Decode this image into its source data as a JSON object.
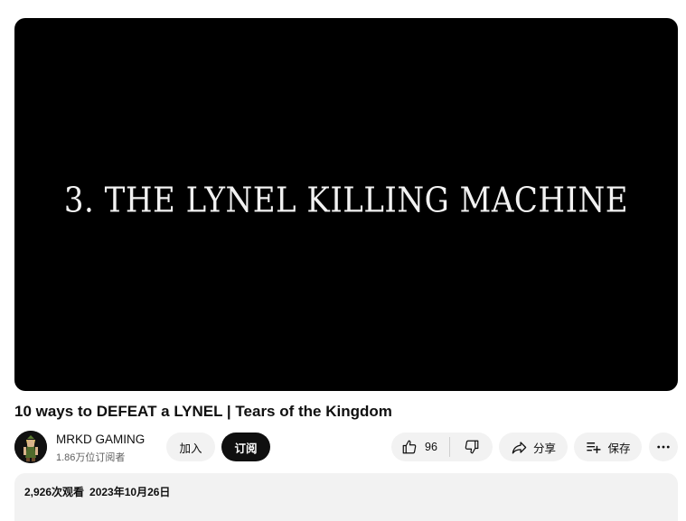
{
  "player": {
    "caption": "3. THE LYNEL KILLING MACHINE"
  },
  "video": {
    "title": "10 ways to DEFEAT a LYNEL | Tears of the Kingdom"
  },
  "channel": {
    "name": "MRKD GAMING",
    "subscribers": "1.86万位订阅者",
    "avatar_icon": "link-character-avatar"
  },
  "actions": {
    "join_label": "加入",
    "subscribe_label": "订阅",
    "like_count": "96",
    "like_icon": "thumbs-up-icon",
    "dislike_icon": "thumbs-down-icon",
    "share_label": "分享",
    "share_icon": "share-arrow-icon",
    "save_label": "保存",
    "save_icon": "playlist-add-icon",
    "more_icon": "more-horizontal-icon"
  },
  "description": {
    "views": "2,926次观看",
    "date": "2023年10月26日"
  },
  "colors": {
    "background": "#ffffff",
    "player": "#000000",
    "pill": "#f2f2f2",
    "subscribe": "#0f0f0f",
    "text_secondary": "#606060"
  }
}
